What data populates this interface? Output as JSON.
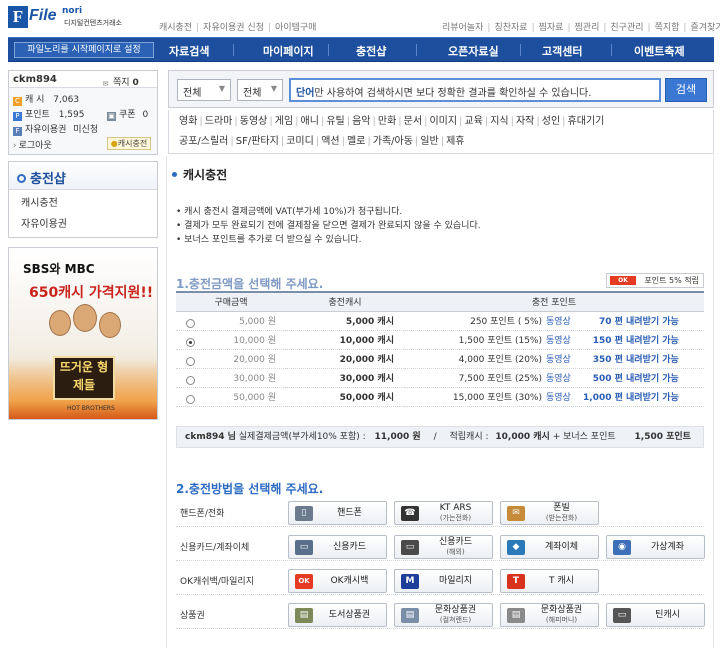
{
  "header": {
    "logo": {
      "word": "File",
      "nori": "nori",
      "sub": "디지털컨텐츠거래소"
    },
    "links_left": [
      "캐시충전",
      "자유이용권 신청",
      "아이템구매"
    ],
    "links_right": [
      "리뷰어놀자",
      "칭찬자료",
      "찜자료",
      "찜관리",
      "친구관리",
      "쪽지함",
      "즐겨찾기 추가"
    ]
  },
  "nav": {
    "set_start": "파일노리를 시작페이지로 설정",
    "items": [
      "자료검색",
      "마이페이지",
      "충전샵",
      "오픈자료실",
      "고객센터",
      "이벤트축제"
    ]
  },
  "user": {
    "id": "ckm894",
    "memo_label": "쪽지",
    "memo_count": "0",
    "cash_label": "캐   시",
    "cash_value": "7,063",
    "point_label": "포인트",
    "point_value": "1,595",
    "coupon_label": "쿠폰",
    "coupon_value": "0",
    "pass_label": "자유이용권",
    "pass_value": "미신청",
    "logout": "로그아웃",
    "cash_charge": "캐시충전"
  },
  "sidebar": {
    "shop_title": "충전샵",
    "links": [
      "캐시충전",
      "자유이용권"
    ],
    "banner": {
      "line1": "SBS와 MBC",
      "line2": "650캐시 가격지원!!",
      "poster": "뜨거운 형제들",
      "sub": "HOT BROTHERS"
    }
  },
  "search": {
    "select1": "전체",
    "select2": "전체",
    "placeholder_bold": "단어",
    "placeholder_rest": "만 사용하여 검색하시면 보다 정확한 결과를 확인하실 수 있습니다.",
    "button": "검색"
  },
  "categories": {
    "row1": [
      "영화",
      "드라마",
      "동영상",
      "게임",
      "애니",
      "유틸",
      "음악",
      "만화",
      "문서",
      "이미지",
      "교육",
      "지식",
      "자작",
      "성인",
      "휴대기기"
    ],
    "row2": [
      "공포/스릴러",
      "SF/판타지",
      "코미디",
      "액션",
      "멜로",
      "가족/아동",
      "일반",
      "제휴"
    ]
  },
  "main": {
    "title": "캐시충전",
    "notes": [
      "캐시 충전시 결제금액에 VAT(부가세 10%)가 청구됩니다.",
      "결제가 모두 완료되기 전에 결제창을 닫으면 결제가 완료되지 않을 수 있습니다.",
      "보너스 포인트를 추가로 더 받으실 수 있습니다."
    ],
    "step1": "1.충전금액을 선택해 주세요.",
    "ok_point": "포인트 5% 적립",
    "ok_logo": "OK",
    "table_headers": [
      "구매금액",
      "충전캐시",
      "충전 포인트"
    ],
    "rows": [
      {
        "price": "5,000 원",
        "cash": "5,000 캐시",
        "point": "250 포인트 ( 5%)",
        "video": "동영상",
        "bonus": "70 편 내려받기 가능",
        "selected": false
      },
      {
        "price": "10,000 원",
        "cash": "10,000 캐시",
        "point": "1,500 포인트 (15%)",
        "video": "동영상",
        "bonus": "150 편 내려받기 가능",
        "selected": true
      },
      {
        "price": "20,000 원",
        "cash": "20,000 캐시",
        "point": "4,000 포인트 (20%)",
        "video": "동영상",
        "bonus": "350 편 내려받기 가능",
        "selected": false
      },
      {
        "price": "30,000 원",
        "cash": "30,000 캐시",
        "point": "7,500 포인트 (25%)",
        "video": "동영상",
        "bonus": "500 편 내려받기 가능",
        "selected": false
      },
      {
        "price": "50,000 원",
        "cash": "50,000 캐시",
        "point": "15,000 포인트 (30%)",
        "video": "동영상",
        "bonus": "1,000 편 내려받기 가능",
        "selected": false
      }
    ],
    "total": {
      "user": "ckm894 님",
      "pay_label": "실제결제금액(부가세10% 포함) :",
      "pay_value": "11,000 원",
      "slash": "/",
      "save_label": "적립캐시 :",
      "save_cash": "10,000 캐시",
      "plus": "+ 보너스 포인트",
      "bonus_point": "1,500 포인트"
    },
    "step2": "2.충전방법을 선택해 주세요.",
    "methods": [
      {
        "label": "핸드폰/전화",
        "buttons": [
          {
            "t": "핸드폰",
            "s": "",
            "icon": "phone-icon",
            "c": "#6b7a8c",
            "g": "▯"
          },
          {
            "t": "KT ARS",
            "s": "(가는전화)",
            "icon": "telephone-icon",
            "c": "#333333",
            "g": "☎"
          },
          {
            "t": "폰빌",
            "s": "(받는전화)",
            "icon": "phonebill-icon",
            "c": "#c58a3a",
            "g": "✉"
          }
        ]
      },
      {
        "label": "신용카드/계좌이체",
        "buttons": [
          {
            "t": "신용카드",
            "s": "",
            "icon": "credit-card-icon",
            "c": "#5a6f8a",
            "g": "▭"
          },
          {
            "t": "신용카드",
            "s": "(해외)",
            "icon": "foreign-card-icon",
            "c": "#4a4a4a",
            "g": "▭"
          },
          {
            "t": "계좌이체",
            "s": "",
            "icon": "bank-transfer-icon",
            "c": "#2a79b8",
            "g": "◆"
          },
          {
            "t": "가상계좌",
            "s": "",
            "icon": "virtual-account-icon",
            "c": "#3d6fb8",
            "g": "◉"
          }
        ]
      },
      {
        "label": "OK캐쉬백/마일리지",
        "buttons": [
          {
            "t": "OK캐시백",
            "s": "",
            "icon": "ok-cashbag-icon",
            "c": "#e53b22",
            "g": "OK"
          },
          {
            "t": "마일리지",
            "s": "",
            "icon": "mileage-icon",
            "c": "#1d3f9a",
            "g": "M"
          },
          {
            "t": "T 캐시",
            "s": "",
            "icon": "t-cash-icon",
            "c": "#d8321f",
            "g": "T"
          }
        ]
      },
      {
        "label": "상품권",
        "buttons": [
          {
            "t": "도서상품권",
            "s": "",
            "icon": "book-voucher-icon",
            "c": "#7c8a5a",
            "g": "▤"
          },
          {
            "t": "문화상품권",
            "s": "(컬쳐랜드)",
            "icon": "culture-voucher-icon",
            "c": "#7a8ea8",
            "g": "▤"
          },
          {
            "t": "문화상품권",
            "s": "(해피머니)",
            "icon": "happymoney-voucher-icon",
            "c": "#8a8a8a",
            "g": "▤"
          },
          {
            "t": "틴캐시",
            "s": "",
            "icon": "teencash-icon",
            "c": "#555555",
            "g": "▭"
          }
        ]
      }
    ]
  }
}
